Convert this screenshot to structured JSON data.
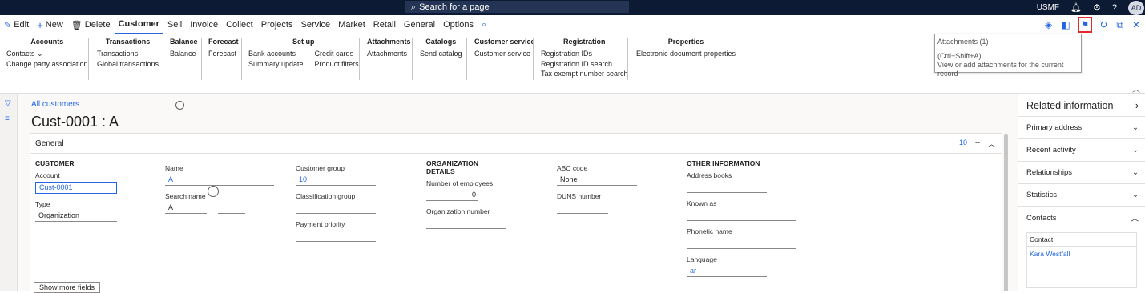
{
  "search": {
    "placeholder": "Search for a page"
  },
  "topbar": {
    "company": "USMF",
    "avatar": "AD"
  },
  "actions": {
    "edit": "Edit",
    "new": "New",
    "delete": "Delete",
    "tabs": [
      "Customer",
      "Sell",
      "Invoice",
      "Collect",
      "Projects",
      "Service",
      "Market",
      "Retail",
      "General",
      "Options"
    ]
  },
  "ribbon": {
    "accounts": {
      "title": "Accounts",
      "items": [
        "Contacts",
        "Change party association"
      ]
    },
    "transactions": {
      "title": "Transactions",
      "items": [
        "Transactions",
        "Global transactions"
      ]
    },
    "balance": {
      "title": "Balance",
      "items": [
        "Balance"
      ]
    },
    "forecast": {
      "title": "Forecast",
      "items": [
        "Forecast"
      ]
    },
    "setup": {
      "title": "Set up",
      "col1": [
        "Bank accounts",
        "Summary update"
      ],
      "col2": [
        "Credit cards",
        "Product filters"
      ]
    },
    "attachments": {
      "title": "Attachments",
      "items": [
        "Attachments"
      ]
    },
    "catalogs": {
      "title": "Catalogs",
      "items": [
        "Send catalog"
      ]
    },
    "custservice": {
      "title": "Customer service",
      "items": [
        "Customer service"
      ]
    },
    "registration": {
      "title": "Registration",
      "items": [
        "Registration IDs",
        "Registration ID search",
        "Tax exempt number search"
      ]
    },
    "properties": {
      "title": "Properties",
      "items": [
        "Electronic document properties"
      ]
    }
  },
  "tooltip": {
    "title": "Attachments (1)",
    "shortcut": "(Ctrl+Shift+A)",
    "desc": "View or add attachments for the current record"
  },
  "page": {
    "breadcrumb": "All customers",
    "title": "Cust-0001 : A"
  },
  "general": {
    "header": "General",
    "count": "10",
    "more": "--",
    "customer": {
      "heading": "CUSTOMER",
      "account_label": "Account",
      "account": "Cust-0001",
      "type_label": "Type",
      "type": "Organization"
    },
    "name": {
      "name_label": "Name",
      "name": "A",
      "search_label": "Search name",
      "search": "A"
    },
    "group": {
      "group_label": "Customer group",
      "group": "10",
      "class_label": "Classification group",
      "payment_label": "Payment priority"
    },
    "org": {
      "heading": "ORGANIZATION DETAILS",
      "employees_label": "Number of employees",
      "employees": "0",
      "orgnum_label": "Organization number"
    },
    "abc": {
      "abc_label": "ABC code",
      "abc": "None",
      "duns_label": "DUNS number"
    },
    "other": {
      "heading": "OTHER INFORMATION",
      "address_label": "Address books",
      "known_label": "Known as",
      "phonetic_label": "Phonetic name",
      "language_label": "Language",
      "language": "ar"
    },
    "show_more": "Show more fields"
  },
  "related": {
    "title": "Related information",
    "items": [
      "Primary address",
      "Recent activity",
      "Relationships",
      "Statistics",
      "Contacts"
    ],
    "contacts": {
      "header": "Contact",
      "value": "Kara Westfall"
    }
  },
  "colors": {
    "accent": "#2266e3",
    "topbar": "#0c1a33",
    "highlight": "#e32a2a"
  }
}
